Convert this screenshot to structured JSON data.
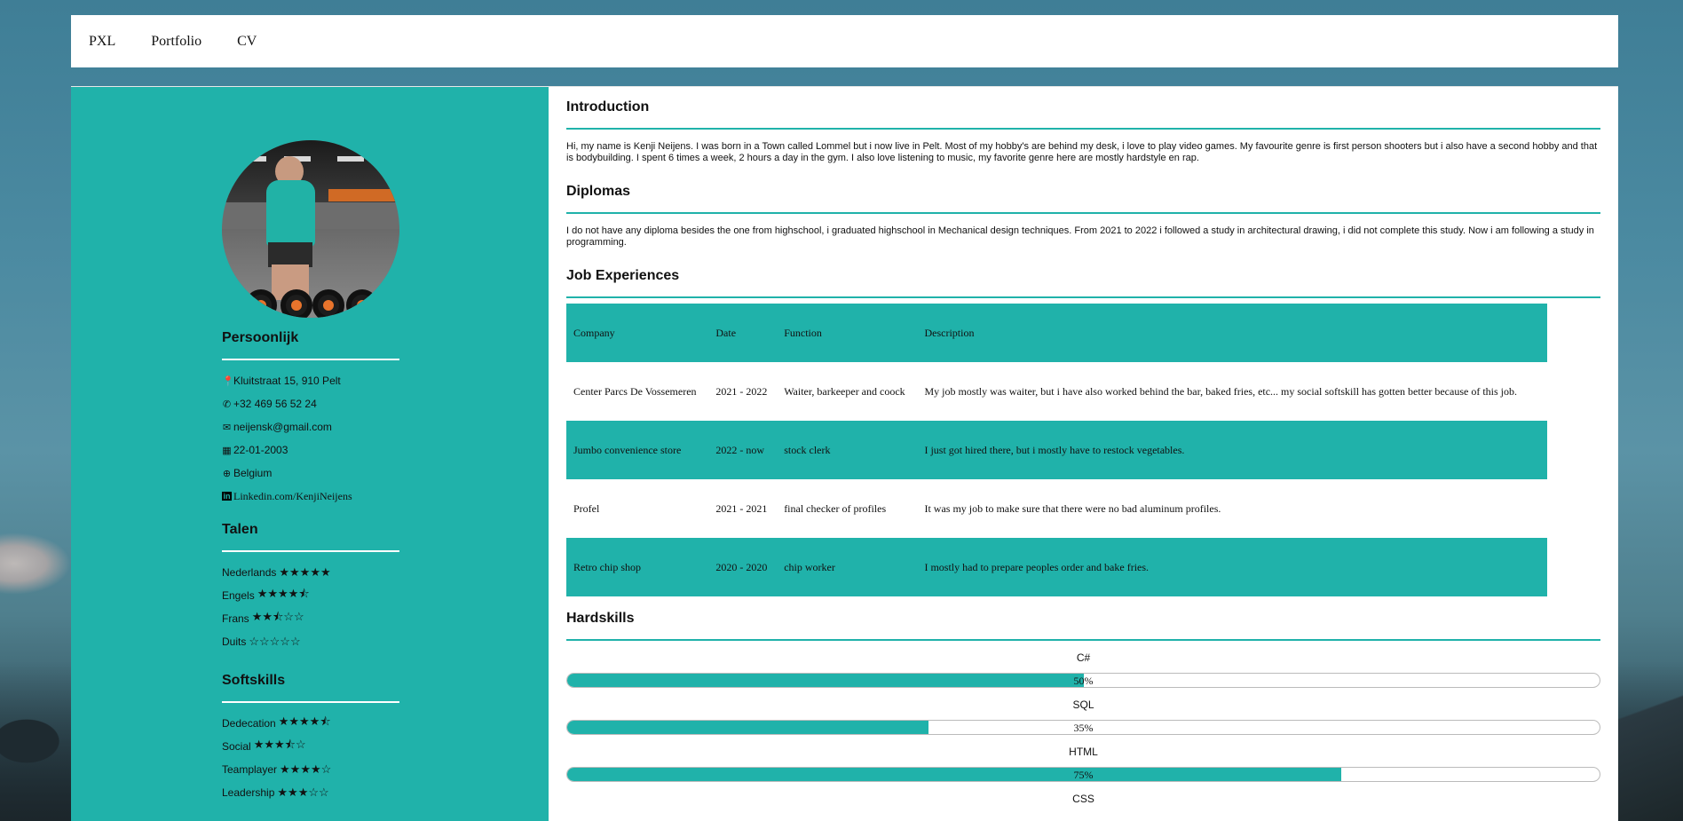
{
  "nav": {
    "items": [
      "PXL",
      "Portfolio",
      "CV"
    ]
  },
  "sidebar": {
    "personal": {
      "heading": "Persoonlijk",
      "address": "Kluitstraat 15, 910 Pelt",
      "phone": "+32 469 56 52 24",
      "email": "neijensk@gmail.com",
      "birthdate": "22-01-2003",
      "country": "Belgium",
      "linkedin": "Linkedin.com/KenjiNeijens"
    },
    "languages": {
      "heading": "Talen",
      "items": [
        {
          "label": "Nederlands",
          "stars": "★★★★★"
        },
        {
          "label": "Engels",
          "stars": "★★★★⯪"
        },
        {
          "label": "Frans",
          "stars": "★★⯪☆☆"
        },
        {
          "label": "Duits",
          "stars": "☆☆☆☆☆"
        }
      ]
    },
    "softskills": {
      "heading": "Softskills",
      "items": [
        {
          "label": "Dedecation",
          "stars": "★★★★⯪"
        },
        {
          "label": "Social",
          "stars": "★★★⯪☆"
        },
        {
          "label": "Teamplayer",
          "stars": "★★★★☆"
        },
        {
          "label": "Leadership",
          "stars": "★★★☆☆"
        }
      ]
    }
  },
  "content": {
    "intro": {
      "heading": "Introduction",
      "text": "Hi, my name is Kenji Neijens. I was born in a Town called Lommel but i now live in Pelt. Most of my hobby's are behind my desk, i love to play video games. My favourite genre is first person shooters but i also have a second hobby and that is bodybuilding. I spent 6 times a week, 2 hours a day in the gym. I also love listening to music, my favorite genre here are mostly hardstyle en rap."
    },
    "diplomas": {
      "heading": "Diplomas",
      "text": "I do not have any diploma besides the one from highschool, i graduated highschool in Mechanical design techniques. From 2021 to 2022 i followed a study in architectural drawing, i did not complete this study. Now i am following a study in programming."
    },
    "jobs": {
      "heading": "Job Experiences",
      "columns": [
        "Company",
        "Date",
        "Function",
        "Description"
      ],
      "rows": [
        [
          "Center Parcs De Vossemeren",
          "2021 - 2022",
          "Waiter, barkeeper and coock",
          "My job mostly was waiter, but i have also worked behind the bar, baked fries, etc... my social softskill has gotten better because of this job."
        ],
        [
          "Jumbo convenience store",
          "2022 - now",
          "stock clerk",
          "I just got hired there, but i mostly have to restock vegetables."
        ],
        [
          "Profel",
          "2021 - 2021",
          "final checker of profiles",
          "It was my job to make sure that there were no bad aluminum profiles."
        ],
        [
          "Retro chip shop",
          "2020 - 2020",
          "chip worker",
          "I mostly had to prepare peoples order and bake fries."
        ]
      ]
    },
    "hardskills": {
      "heading": "Hardskills",
      "items": [
        {
          "label": "C#",
          "pct_text": "50%",
          "value": 50
        },
        {
          "label": "SQL",
          "pct_text": "35%",
          "value": 35
        },
        {
          "label": "HTML",
          "pct_text": "75%",
          "value": 75
        },
        {
          "label": "CSS",
          "pct_text": "",
          "value": 0
        }
      ]
    }
  },
  "colors": {
    "accent": "#20b2aa"
  }
}
